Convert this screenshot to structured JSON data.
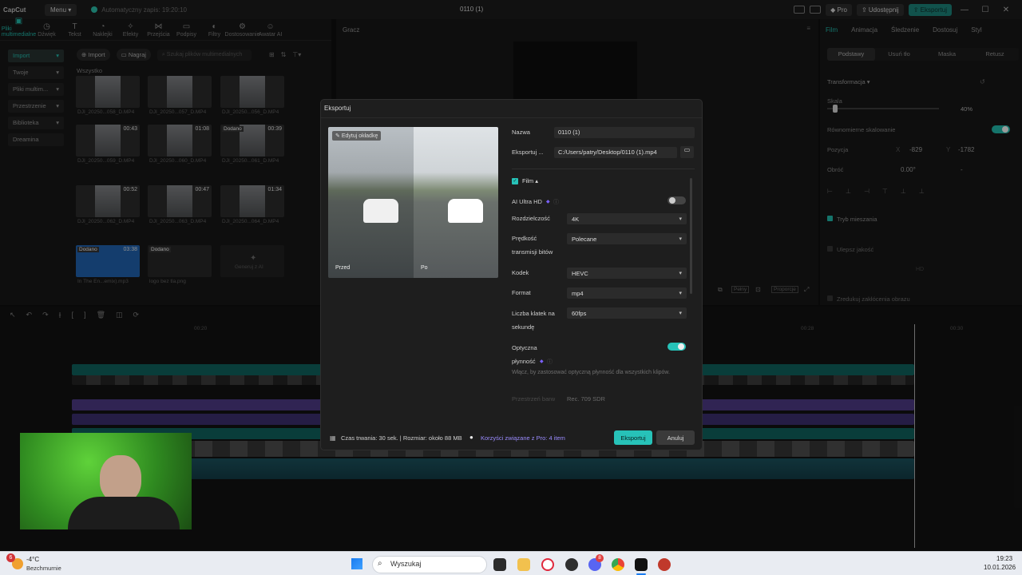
{
  "app": {
    "logo": "CapCut",
    "menu_label": "Menu",
    "autosave": "Automatyczny zapis: 19:20:10",
    "project_title": "0110 (1)",
    "pro_label": "Pro",
    "share_label": "Udostępnij",
    "export_label": "Eksportuj"
  },
  "toolbar": {
    "items": [
      {
        "label": "Pliki multimedialne",
        "icon": "media-icon"
      },
      {
        "label": "Dźwięk",
        "icon": "audio-icon"
      },
      {
        "label": "Tekst",
        "icon": "text-icon"
      },
      {
        "label": "Naklejki",
        "icon": "sticker-icon"
      },
      {
        "label": "Efekty",
        "icon": "effects-icon"
      },
      {
        "label": "Przejścia",
        "icon": "transition-icon"
      },
      {
        "label": "Podpisy",
        "icon": "captions-icon"
      },
      {
        "label": "Filtry",
        "icon": "filter-icon"
      },
      {
        "label": "Dostosowanie",
        "icon": "adjust-icon"
      },
      {
        "label": "Awatar AI",
        "icon": "avatar-icon"
      }
    ]
  },
  "sidebar": {
    "items": [
      "Import",
      "Twoje",
      "Pliki multim...",
      "Przestrzenie",
      "Biblioteka",
      "Dreamina"
    ]
  },
  "media": {
    "import_label": "Import",
    "record_label": "Nagraj",
    "search_placeholder": "Szukaj plików multimedialnych",
    "all_label": "Wszystko",
    "files": [
      {
        "name": "DJI_20250...058_D.MP4",
        "duration": "",
        "tag": ""
      },
      {
        "name": "DJI_20250...057_D.MP4",
        "duration": "",
        "tag": ""
      },
      {
        "name": "DJI_20250...056_D.MP4",
        "duration": "",
        "tag": ""
      },
      {
        "name": "DJI_20250...059_D.MP4",
        "duration": "00:43",
        "tag": ""
      },
      {
        "name": "DJI_20250...060_D.MP4",
        "duration": "01:08",
        "tag": ""
      },
      {
        "name": "DJI_20250...061_D.MP4",
        "duration": "00:39",
        "tag": "Dodano"
      },
      {
        "name": "DJI_20250...062_D.MP4",
        "duration": "00:52",
        "tag": ""
      },
      {
        "name": "DJI_20250...063_D.MP4",
        "duration": "00:47",
        "tag": ""
      },
      {
        "name": "DJI_20250...064_D.MP4",
        "duration": "01:34",
        "tag": ""
      },
      {
        "name": "In The En...emix).mp3",
        "duration": "03:38",
        "tag": "Dodano"
      },
      {
        "name": "logo bez tla.png",
        "duration": "",
        "tag": "Dodano"
      },
      {
        "name": "",
        "duration": "",
        "tag": "",
        "ai_label": "Generuj z AI"
      }
    ]
  },
  "player": {
    "title": "Gracz",
    "ratio_label": "Proporcje",
    "pelny_label": "Pełny"
  },
  "right_panel": {
    "tabs": [
      "Film",
      "Animacja",
      "Śledzenie",
      "Dostosuj",
      "Styl"
    ],
    "subtabs": [
      "Podstawy",
      "Usuń tło",
      "Maska",
      "Retusz"
    ],
    "transform_label": "Transformacja",
    "scale_label": "Skala",
    "scale_value": "40%",
    "scale_fraction": 0.4,
    "uniform_label": "Równomierne skalowanie",
    "position_label": "Pozycja",
    "pos_x_label": "X",
    "pos_x": "-829",
    "pos_y_label": "Y",
    "pos_y": "-1782",
    "rotate_label": "Obróć",
    "rotate_value": "0.00°",
    "rotate_extra": "-",
    "blend_label": "Tryb mieszania",
    "enhance_label": "Ulepsz jakość",
    "enhance_value": "HD",
    "noise_label": "Zredukuj zakłócenia obrazu"
  },
  "timeline": {
    "ticks": [
      "00:20",
      "00:28",
      "00:30"
    ]
  },
  "export_dialog": {
    "title": "Eksportuj",
    "edit_cover": "Edytuj okładkę",
    "before_label": "Przed",
    "after_label": "Po",
    "name_label": "Nazwa",
    "name_value": "0110 (1)",
    "export_to_label": "Eksportuj ...",
    "export_path": "C:/Users/patry/Desktop/0110 (1).mp4",
    "film_label": "Film",
    "ai_ultra_label": "AI Ultra HD",
    "resolution_label": "Rozdzielczość",
    "resolution_value": "4K",
    "bitrate_label": "Prędkość transmisji bitów",
    "bitrate_value": "Polecane",
    "codec_label": "Kodek",
    "codec_value": "HEVC",
    "format_label": "Format",
    "format_value": "mp4",
    "fps_label": "Liczba klatek na sekundę",
    "fps_value": "60fps",
    "optical_label": "Optyczna płynność",
    "optical_desc": "Włącz, by zastosować optyczną płynność dla wszystkich klipów.",
    "colorspace_label": "Przestrzeń barw",
    "colorspace_value": "Rec. 709 SDR",
    "footer_info": "Czas trwania: 30 sek. | Rozmiar: około 88 MB",
    "pro_benefits": "Korzyści związane z Pro: 4 item",
    "export_button": "Eksportuj",
    "cancel_button": "Anuluj"
  },
  "taskbar": {
    "weather_temp": "-4°C",
    "weather_desc": "Bezchmurnie",
    "weather_badge": "6",
    "search_label": "Wyszukaj",
    "time": "19:23",
    "date": "10.01.2026",
    "discord_badge": "8"
  },
  "colors": {
    "accent": "#21b3a5",
    "export_primary": "#27c2b8",
    "dialog_bg": "#1e1e1e"
  }
}
